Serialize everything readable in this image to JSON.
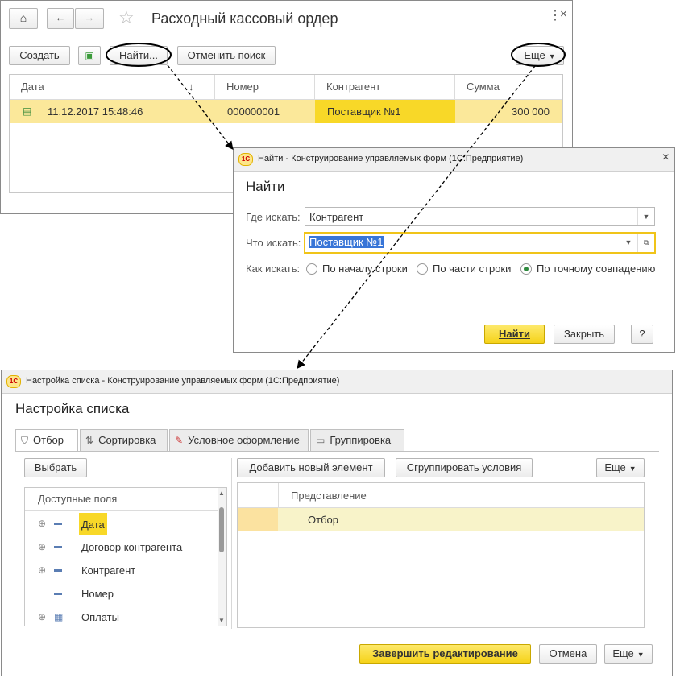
{
  "main_window": {
    "title": "Расходный кассовый ордер",
    "toolbar": {
      "create": "Создать",
      "find": "Найти...",
      "cancel_search": "Отменить поиск",
      "more": "Еще"
    },
    "columns": [
      "Дата",
      "Номер",
      "Контрагент",
      "Сумма"
    ],
    "sort_indicator": "↓",
    "row": {
      "date": "11.12.2017 15:48:46",
      "number": "000000001",
      "contractor": "Поставщик №1",
      "sum": "300 000"
    }
  },
  "find_dialog": {
    "window_title": "Найти - Конструирование управляемых форм  (1С:Предприятие)",
    "heading": "Найти",
    "where_label": "Где искать:",
    "where_value": "Контрагент",
    "what_label": "Что искать:",
    "what_value": "Поставщик №1",
    "how_label": "Как искать:",
    "options": [
      "По началу строки",
      "По части строки",
      "По точному совпадению"
    ],
    "selected_option": 2,
    "find_button": "Найти",
    "close_button": "Закрыть",
    "help_button": "?"
  },
  "settings_dialog": {
    "window_title": "Настройка списка - Конструирование управляемых форм  (1С:Предприятие)",
    "heading": "Настройка списка",
    "tabs": [
      "Отбор",
      "Сортировка",
      "Условное оформление",
      "Группировка"
    ],
    "select_button": "Выбрать",
    "add_element_button": "Добавить новый элемент",
    "group_conditions_button": "Сгруппировать условия",
    "more_button": "Еще",
    "available_fields_header": "Доступные поля",
    "fields": [
      "Дата",
      "Договор контрагента",
      "Контрагент",
      "Номер",
      "Оплаты"
    ],
    "representation_header": "Представление",
    "filter_row": "Отбор",
    "finish_button": "Завершить редактирование",
    "cancel_button": "Отмена",
    "more_bottom_button": "Еще"
  },
  "colors": {
    "highlight": "#fbe89a",
    "selected_cell": "#f8d828",
    "accent_yellow": "#f5d21a",
    "selection_blue": "#3875d7"
  }
}
